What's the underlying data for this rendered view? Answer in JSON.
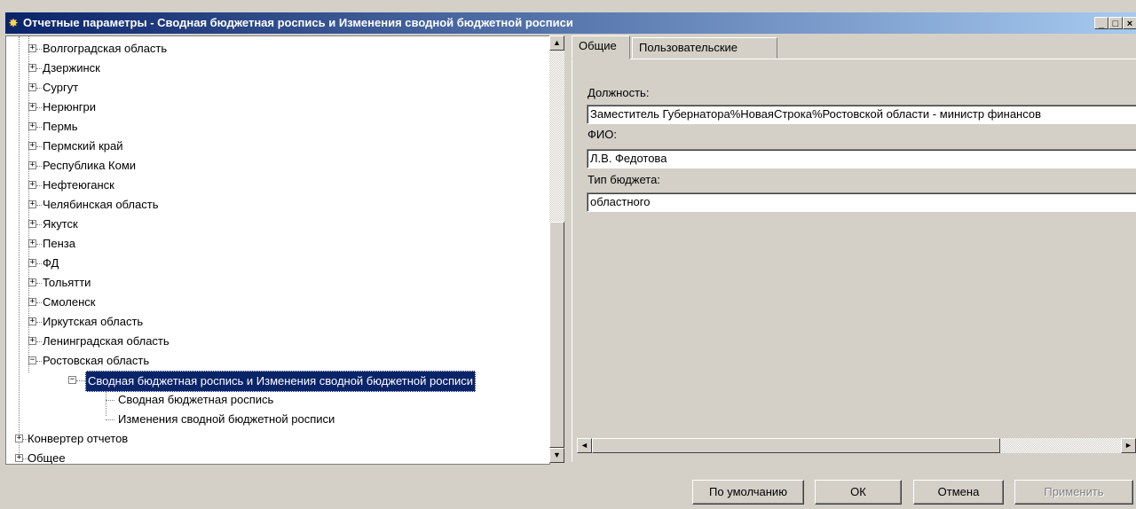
{
  "window": {
    "title": "Отчетные параметры - Сводная бюджетная роспись и Изменения сводной бюджетной росписи",
    "controls": {
      "minimize": "_",
      "maximize": "□",
      "close": "×"
    }
  },
  "tree": {
    "items": [
      {
        "label": "Волгоградская область",
        "expander": "+"
      },
      {
        "label": "Дзержинск",
        "expander": "+"
      },
      {
        "label": "Сургут",
        "expander": "+"
      },
      {
        "label": "Нерюнгри",
        "expander": "+"
      },
      {
        "label": "Пермь",
        "expander": "+"
      },
      {
        "label": "Пермский край",
        "expander": "+"
      },
      {
        "label": "Республика Коми",
        "expander": "+"
      },
      {
        "label": "Нефтеюганск",
        "expander": "+"
      },
      {
        "label": "Челябинская область",
        "expander": "+"
      },
      {
        "label": "Якутск",
        "expander": "+"
      },
      {
        "label": "Пенза",
        "expander": "+"
      },
      {
        "label": "ФД",
        "expander": "+"
      },
      {
        "label": "Тольятти",
        "expander": "+"
      },
      {
        "label": "Смоленск",
        "expander": "+"
      },
      {
        "label": "Иркутская область",
        "expander": "+"
      },
      {
        "label": "Ленинградская область",
        "expander": "+"
      },
      {
        "label": "Ростовская область",
        "expander": "−"
      },
      {
        "label": "Сводная бюджетная роспись и Изменения сводной бюджетной росписи",
        "expander": "−",
        "selected": true
      },
      {
        "label": "Сводная бюджетная роспись"
      },
      {
        "label": "Изменения сводной бюджетной росписи"
      },
      {
        "label": "Конвертер отчетов",
        "expander": "+"
      },
      {
        "label": "Общее",
        "expander": "+"
      }
    ]
  },
  "tabs": [
    {
      "label": "Общие",
      "active": true
    },
    {
      "label": "Пользовательские",
      "active": false
    }
  ],
  "form": {
    "position_label": "Должность:",
    "position_value": "Заместитель Губернатора%НоваяСтрока%Ростовской области - министр финансов",
    "fio_label": "ФИО:",
    "fio_value": "Л.В. Федотова",
    "budget_type_label": "Тип бюджета:",
    "budget_type_value": "областного"
  },
  "buttons": {
    "default": "По умолчанию",
    "ok": "ОК",
    "cancel": "Отмена",
    "apply": "Применить"
  },
  "scroll": {
    "up": "▲",
    "down": "▼",
    "left": "◄",
    "right": "►"
  }
}
